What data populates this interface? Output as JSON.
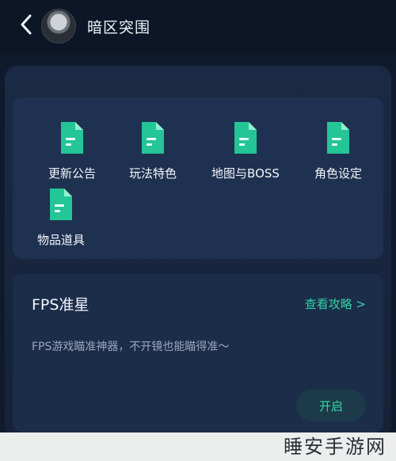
{
  "header": {
    "title": "暗区突围",
    "back_icon": "chevron-left-icon",
    "avatar": "avatar"
  },
  "grid": {
    "items": [
      {
        "label": "更新公告",
        "icon": "document-icon"
      },
      {
        "label": "玩法特色",
        "icon": "document-icon"
      },
      {
        "label": "地图与BOSS",
        "icon": "document-icon"
      },
      {
        "label": "角色设定",
        "icon": "document-icon"
      },
      {
        "label": "物品道具",
        "icon": "document-icon"
      }
    ]
  },
  "fps_card": {
    "title": "FPS准星",
    "link_label": "查看攻略 >",
    "description": "FPS游戏瞄准神器，不开镜也能瞄得准～",
    "button_label": "开启"
  },
  "watermark": "睡安手游网",
  "colors": {
    "background": "#0f1a2c",
    "panel": "#1a2a44",
    "card": "#1f3150",
    "accent": "#32d4a6",
    "text": "#f2f6fb"
  }
}
